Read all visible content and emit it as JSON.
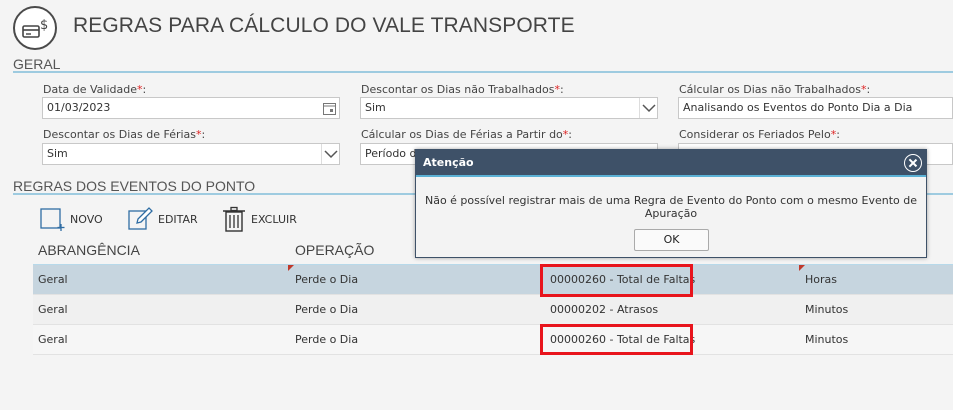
{
  "header": {
    "title": "REGRAS PARA CÁLCULO DO VALE TRANSPORTE"
  },
  "geral": {
    "section_title": "GERAL",
    "fields": [
      {
        "label": "Data de Validade",
        "value": "01/03/2023"
      },
      {
        "label": "Descontar os Dias não Trabalhados",
        "value": "Sim"
      },
      {
        "label": "Cálcular os Dias não Trabalhados",
        "value": "Analisando os Eventos do Ponto Dia a Dia"
      },
      {
        "label": "Descontar os Dias de Férias",
        "value": "Sim"
      },
      {
        "label": "Cálcular os Dias de Férias a Partir do",
        "value": "Período de"
      },
      {
        "label": "Considerar os Feriados Pelo",
        "value": ""
      }
    ]
  },
  "regras": {
    "section_title": "REGRAS DOS EVENTOS DO PONTO",
    "toolbar": {
      "novo": "NOVO",
      "editar": "EDITAR",
      "excluir": "EXCLUIR"
    },
    "columns": {
      "abrangencia": "ABRANGÊNCIA",
      "operacao": "OPERAÇÃO"
    },
    "rows": [
      {
        "abrangencia": "Geral",
        "operacao": "Perde o Dia",
        "evento": "00000260 - Total de Faltas",
        "unidade": "Horas"
      },
      {
        "abrangencia": "Geral",
        "operacao": "Perde o Dia",
        "evento": "00000202 - Atrasos",
        "unidade": "Minutos"
      },
      {
        "abrangencia": "Geral",
        "operacao": "Perde o Dia",
        "evento": "00000260 - Total de Faltas",
        "unidade": "Minutos"
      }
    ]
  },
  "dialog": {
    "title": "Atenção",
    "message": "Não é possível registrar mais de uma Regra de Evento do Ponto com o mesmo Evento de Apuração",
    "ok_label": "OK"
  },
  "colors": {
    "accent_line": "#9ecbe0",
    "dialog_header": "#3e5168",
    "required": "#dd2222",
    "highlight_box": "#e8141c",
    "selected_row": "#c6d5df"
  }
}
